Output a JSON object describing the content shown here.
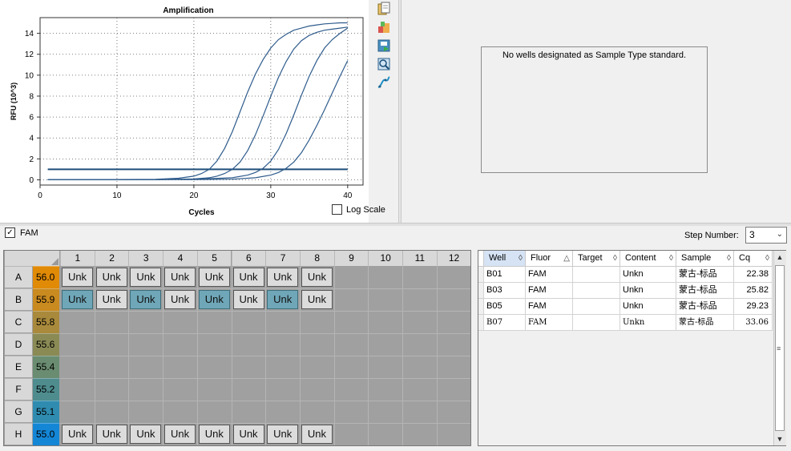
{
  "chart": {
    "title": "Amplification",
    "xlabel": "Cycles",
    "ylabel": "RFU (10^3)",
    "log_scale_label": "Log Scale",
    "log_scale_checked": false
  },
  "chart_data": {
    "type": "line",
    "title": "Amplification",
    "xlabel": "Cycles",
    "ylabel": "RFU (10^3)",
    "xlim": [
      0,
      42
    ],
    "ylim": [
      -0.5,
      15.5
    ],
    "xticks": [
      0,
      10,
      20,
      30,
      40
    ],
    "yticks": [
      0,
      2,
      4,
      6,
      8,
      10,
      12,
      14
    ],
    "grid": true,
    "threshold": 1.0,
    "series": [
      {
        "x": [
          1,
          5,
          10,
          15,
          18,
          20,
          21,
          22,
          23,
          24,
          25,
          26,
          27,
          28,
          29,
          30,
          31,
          32,
          33,
          34,
          35,
          36,
          37,
          38,
          39,
          40
        ],
        "values": [
          0.02,
          0.02,
          0.03,
          0.05,
          0.15,
          0.35,
          0.6,
          1.0,
          1.8,
          3.0,
          4.6,
          6.5,
          8.4,
          10.1,
          11.5,
          12.6,
          13.4,
          13.9,
          14.3,
          14.5,
          14.7,
          14.8,
          14.9,
          14.95,
          15.0,
          15.0
        ]
      },
      {
        "x": [
          1,
          5,
          10,
          15,
          20,
          22,
          23,
          24,
          25,
          26,
          27,
          28,
          29,
          30,
          31,
          32,
          33,
          34,
          35,
          36,
          37,
          38,
          39,
          40
        ],
        "values": [
          0.02,
          0.02,
          0.02,
          0.03,
          0.08,
          0.2,
          0.35,
          0.6,
          1.0,
          1.7,
          2.8,
          4.3,
          6.1,
          8.0,
          9.8,
          11.3,
          12.5,
          13.3,
          13.8,
          14.1,
          14.3,
          14.4,
          14.5,
          14.6
        ]
      },
      {
        "x": [
          1,
          5,
          10,
          15,
          20,
          25,
          27,
          28,
          29,
          30,
          31,
          32,
          33,
          34,
          35,
          36,
          37,
          38,
          39,
          40
        ],
        "values": [
          0.02,
          0.02,
          0.02,
          0.02,
          0.05,
          0.2,
          0.45,
          0.7,
          1.1,
          1.8,
          2.9,
          4.4,
          6.2,
          8.1,
          9.9,
          11.4,
          12.6,
          13.4,
          14.0,
          14.5
        ]
      },
      {
        "x": [
          1,
          5,
          10,
          15,
          20,
          25,
          28,
          30,
          31,
          32,
          33,
          34,
          35,
          36,
          37,
          38,
          39,
          40
        ],
        "values": [
          0.02,
          0.02,
          0.02,
          0.02,
          0.03,
          0.06,
          0.2,
          0.45,
          0.7,
          1.1,
          1.7,
          2.6,
          3.8,
          5.2,
          6.7,
          8.3,
          9.9,
          11.4
        ]
      }
    ]
  },
  "standard_message": "No wells designated as Sample Type standard.",
  "fluor_filter": {
    "label": "FAM",
    "checked": true
  },
  "step": {
    "label": "Step Number:",
    "value": "3"
  },
  "plate": {
    "columns": [
      "1",
      "2",
      "3",
      "4",
      "5",
      "6",
      "7",
      "8",
      "9",
      "10",
      "11",
      "12"
    ],
    "rows": [
      {
        "label": "A",
        "temp": "56.0",
        "color": "#e08a06"
      },
      {
        "label": "B",
        "temp": "55.9",
        "color": "#c98a1f"
      },
      {
        "label": "C",
        "temp": "55.8",
        "color": "#a98a3c"
      },
      {
        "label": "D",
        "temp": "55.6",
        "color": "#8a8a55"
      },
      {
        "label": "E",
        "temp": "55.4",
        "color": "#6a8c70"
      },
      {
        "label": "F",
        "temp": "55.2",
        "color": "#4e8c8e"
      },
      {
        "label": "G",
        "temp": "55.1",
        "color": "#2f8cb0"
      },
      {
        "label": "H",
        "temp": "55.0",
        "color": "#1486d6"
      }
    ],
    "wells": {
      "A": [
        "Unk",
        "Unk",
        "Unk",
        "Unk",
        "Unk",
        "Unk",
        "Unk",
        "Unk"
      ],
      "B": [
        "Unk",
        "Unk",
        "Unk",
        "Unk",
        "Unk",
        "Unk",
        "Unk",
        "Unk"
      ],
      "H": [
        "Unk",
        "Unk",
        "Unk",
        "Unk",
        "Unk",
        "Unk",
        "Unk",
        "Unk"
      ]
    }
  },
  "results": {
    "headers": [
      "Well",
      "Fluor",
      "Target",
      "Content",
      "Sample",
      "Cq"
    ],
    "rows": [
      {
        "well": "B01",
        "fluor": "FAM",
        "target": "",
        "content": "Unkn",
        "sample": "蒙古-标品",
        "cq": "22.38"
      },
      {
        "well": "B03",
        "fluor": "FAM",
        "target": "",
        "content": "Unkn",
        "sample": "蒙古-标品",
        "cq": "25.82"
      },
      {
        "well": "B05",
        "fluor": "FAM",
        "target": "",
        "content": "Unkn",
        "sample": "蒙古-标品",
        "cq": "29.23"
      },
      {
        "well": "B07",
        "fluor": "FAM",
        "target": "",
        "content": "Unkn",
        "sample": "蒙古-标品",
        "cq": "33.06"
      }
    ]
  },
  "icons": [
    "copy-icon",
    "export-icon",
    "save-image-icon",
    "zoom-icon",
    "line-style-icon"
  ]
}
